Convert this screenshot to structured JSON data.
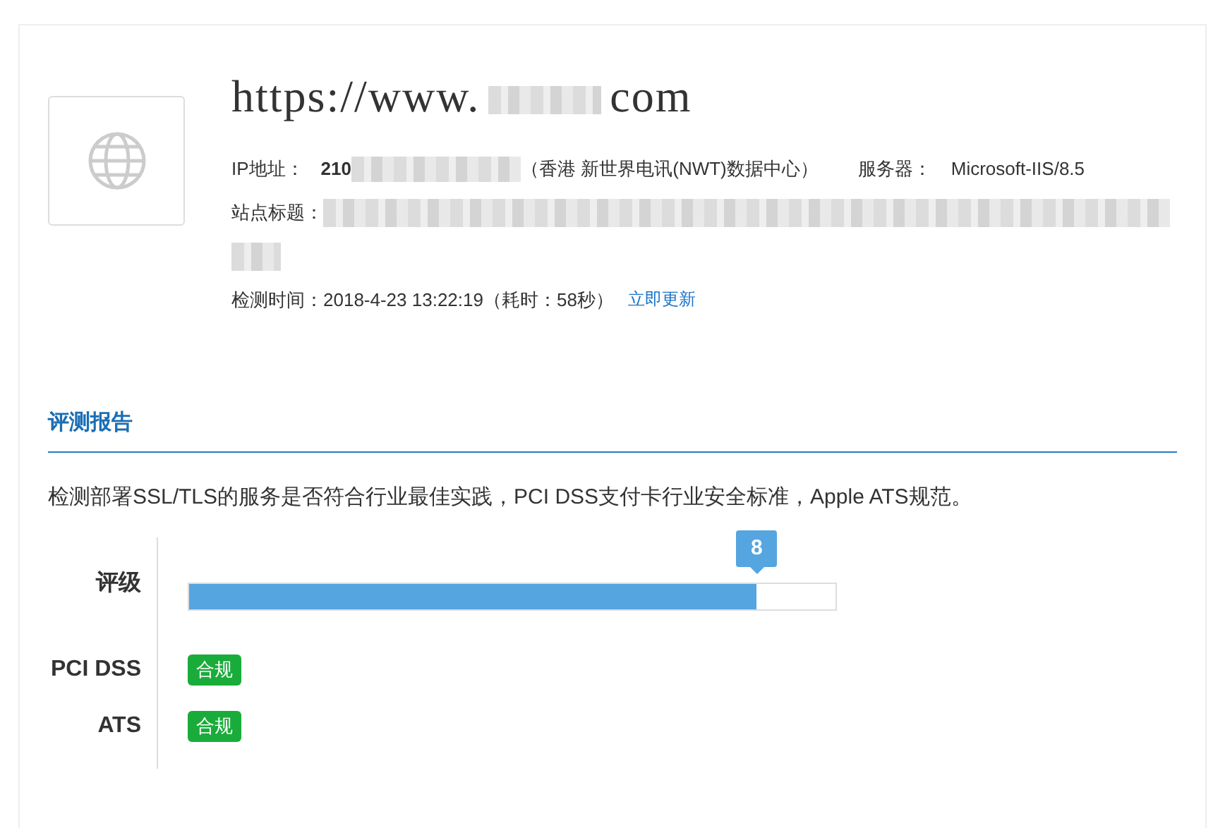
{
  "site": {
    "url_prefix": "https://www.",
    "url_suffix": "com",
    "ip_label": "IP地址：",
    "ip_value": "210",
    "ip_location": "（香港 新世界电讯(NWT)数据中心）",
    "server_label": "服务器：",
    "server_value": "Microsoft-IIS/8.5",
    "title_label": "站点标题：",
    "time_text": "检测时间：2018-4-23 13:22:19（耗时：58秒）",
    "refresh_link": "立即更新"
  },
  "report": {
    "heading": "评测报告",
    "description": "检测部署SSL/TLS的服务是否符合行业最佳实践，PCI DSS支付卡行业安全标准，Apple ATS规范。",
    "rating": {
      "label": "评级",
      "score": "8",
      "level": 0.878
    },
    "compliance": [
      {
        "label": "PCI DSS",
        "status": "合规",
        "compliant": true
      },
      {
        "label": "ATS",
        "status": "合规",
        "compliant": true
      }
    ]
  }
}
